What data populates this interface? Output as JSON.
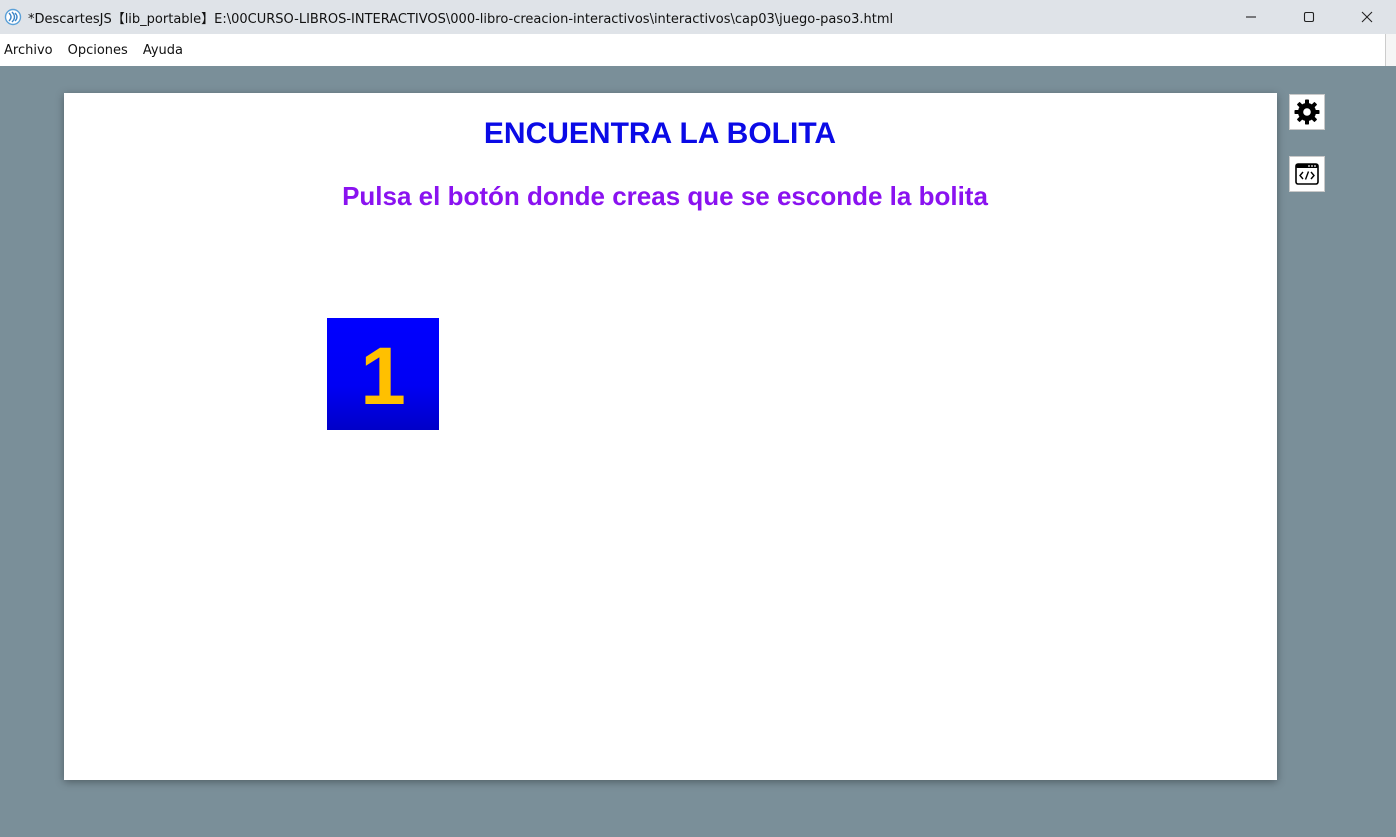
{
  "window": {
    "title": "*DescartesJS【lib_portable】E:\\00CURSO-LIBROS-INTERACTIVOS\\000-libro-creacion-interactivos\\interactivos\\cap03\\juego-paso3.html",
    "app_icon": "descartes-icon",
    "controls": [
      "minimize-icon",
      "maximize-icon",
      "close-icon"
    ]
  },
  "menubar": {
    "items": [
      {
        "label": "Archivo"
      },
      {
        "label": "Opciones"
      },
      {
        "label": "Ayuda"
      }
    ]
  },
  "scene": {
    "title": "ENCUENTRA LA BOLITA",
    "subtitle": "Pulsa el botón donde creas que se esconde la bolita",
    "button_label": "1",
    "colors": {
      "title": "#0a0ae6",
      "subtitle": "#8a12f0",
      "button_bg": "#0000ff",
      "button_text": "#ffc000",
      "background": "#7a8f99"
    }
  },
  "side_tools": {
    "config": "gear-icon",
    "code": "code-window-icon"
  }
}
